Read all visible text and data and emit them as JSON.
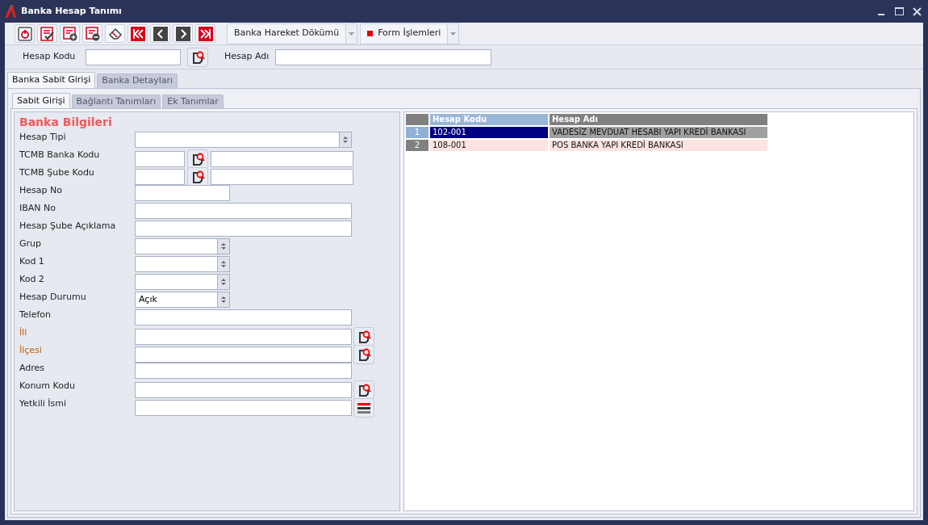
{
  "window": {
    "title": "Banka Hesap Tanımı"
  },
  "toolbar": {
    "icon_buttons": [
      {
        "kind": "power"
      },
      {
        "kind": "check-list"
      },
      {
        "kind": "add-list"
      },
      {
        "kind": "remove-list"
      },
      {
        "kind": "eraser"
      },
      {
        "kind": "first"
      },
      {
        "kind": "prev"
      },
      {
        "kind": "next"
      },
      {
        "kind": "last"
      }
    ],
    "menus": [
      {
        "label": "Banka Hareket Dökümü",
        "marker": false
      },
      {
        "label": "Form İşlemleri",
        "marker": true
      }
    ]
  },
  "search": {
    "code_label": "Hesap Kodu",
    "name_label": "Hesap Adı"
  },
  "tabs": [
    {
      "label": "Banka Sabit Girişi",
      "selected": true
    },
    {
      "label": "Banka Detayları",
      "selected": false
    }
  ],
  "subtabs": [
    {
      "label": "Sabit Girişi",
      "selected": true
    },
    {
      "label": "Bağlantı Tanımları",
      "selected": false
    },
    {
      "label": "Ek Tanımlar",
      "selected": false
    }
  ],
  "form": {
    "title": "Banka Bilgileri",
    "fields": [
      {
        "label": "Hesap Tipi",
        "kind": "combo-wide",
        "emphasis": false
      },
      {
        "label": "TCMB Banka Kodu",
        "kind": "lookup-pair",
        "emphasis": false
      },
      {
        "label": "TCMB Şube Kodu",
        "kind": "lookup-pair",
        "emphasis": false
      },
      {
        "label": "Hesap No",
        "kind": "text-short",
        "emphasis": false
      },
      {
        "label": "IBAN No",
        "kind": "text-wide",
        "emphasis": false
      },
      {
        "label": "Hesap Şube Açıklama",
        "kind": "text-wide",
        "emphasis": false
      },
      {
        "label": "Grup",
        "kind": "combo-short",
        "emphasis": false
      },
      {
        "label": "Kod 1",
        "kind": "combo-short",
        "emphasis": false
      },
      {
        "label": "Kod 2",
        "kind": "combo-short",
        "emphasis": false
      },
      {
        "label": "Hesap Durumu",
        "kind": "combo-short",
        "emphasis": false,
        "value": "Açık"
      },
      {
        "label": "Telefon",
        "kind": "text-wide",
        "emphasis": false
      },
      {
        "label": "İli",
        "kind": "text-lookup",
        "emphasis": true
      },
      {
        "label": "İlçesi",
        "kind": "text-lookup",
        "emphasis": true
      },
      {
        "label": "Adres",
        "kind": "text-wide",
        "emphasis": false
      },
      {
        "label": "Konum Kodu",
        "kind": "text-lookup",
        "emphasis": false
      },
      {
        "label": "Yetkili İsmi",
        "kind": "text-list",
        "emphasis": false
      }
    ]
  },
  "grid": {
    "columns": [
      {
        "label": "Hesap Kodu",
        "selected": true
      },
      {
        "label": "Hesap Adı",
        "selected": false
      }
    ],
    "rows": [
      {
        "number": "1",
        "code": "102-001",
        "name": "VADESİZ MEVDUAT HESABI YAPI KREDİ BANKASI",
        "selected": true
      },
      {
        "number": "2",
        "code": "108-001",
        "name": "POS BANKA YAPI KREDİ BANKASI",
        "selected": false
      }
    ]
  }
}
